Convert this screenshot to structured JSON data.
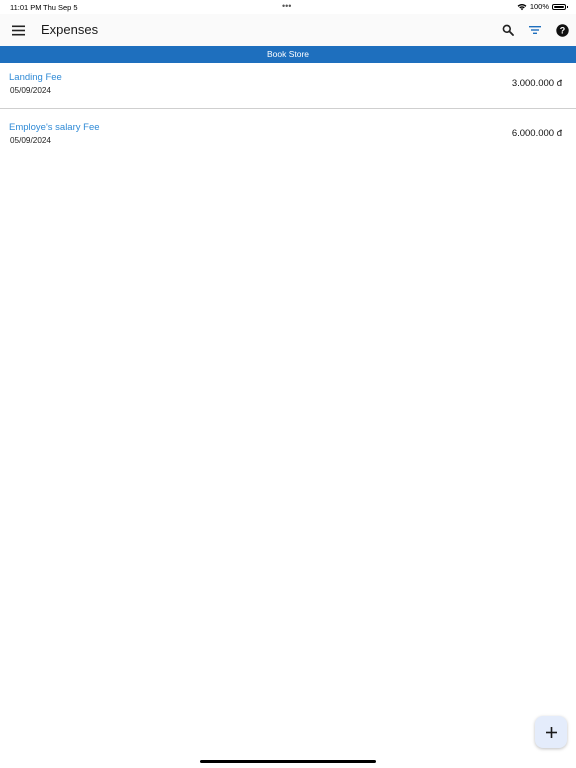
{
  "status_bar": {
    "time": "11:01 PM",
    "date": "Thu Sep 5",
    "battery": "100%",
    "wifi_icon": "wifi-icon",
    "battery_icon": "battery-icon",
    "multitask_icon": "ellipsis-icon"
  },
  "app_bar": {
    "title": "Expenses",
    "menu_icon": "menu-icon",
    "search_icon": "search-icon",
    "filter_icon": "filter-icon",
    "help_icon": "help-icon",
    "accent_color": "#1e6fbe"
  },
  "section": {
    "title": "Book Store",
    "background": "#1e6fbe"
  },
  "expenses": [
    {
      "name": "Landing Fee",
      "date": "05/09/2024",
      "amount": "3.000.000 đ"
    },
    {
      "name": "Employe's salary Fee",
      "date": "05/09/2024",
      "amount": "6.000.000 đ"
    }
  ],
  "fab": {
    "icon": "plus-icon"
  },
  "colors": {
    "name_text": "#2f8ad6",
    "fab_background": "#e4ecfb"
  }
}
